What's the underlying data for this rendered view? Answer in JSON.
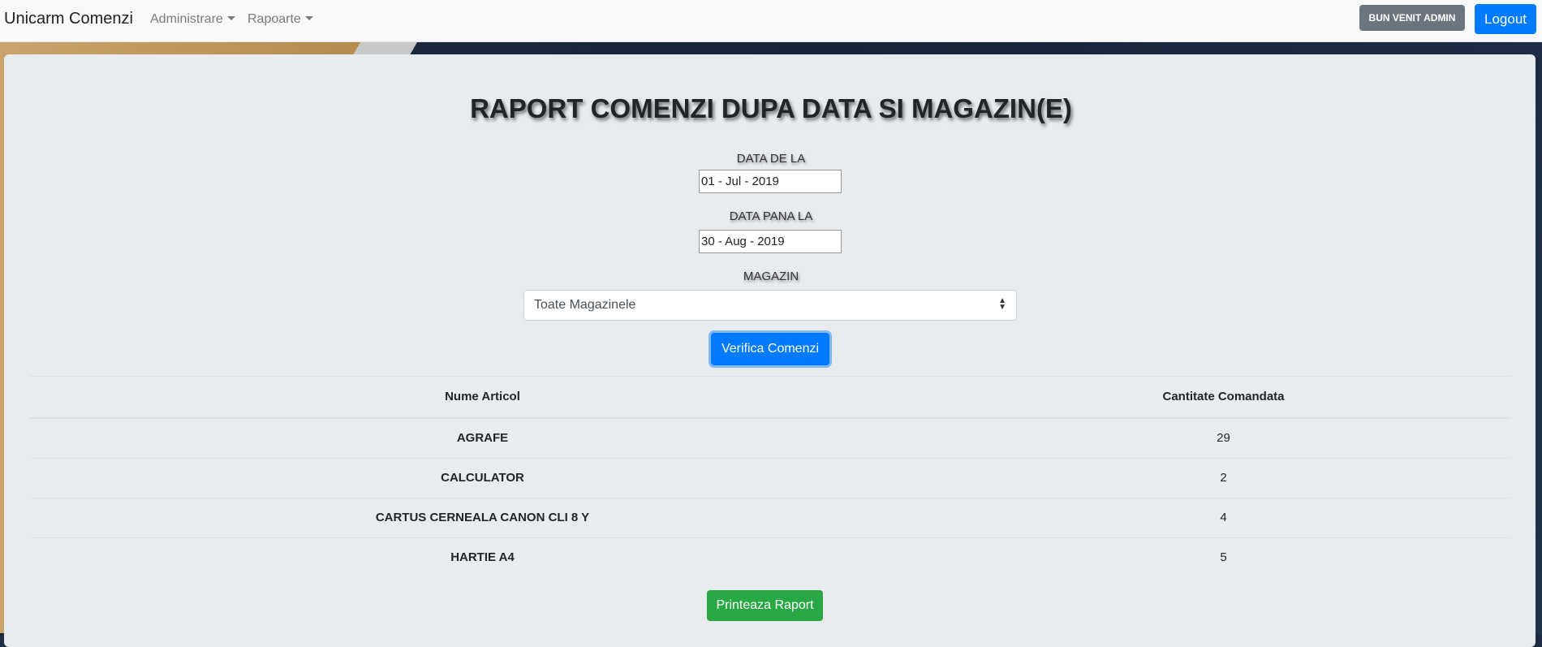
{
  "navbar": {
    "brand": "Unicarm Comenzi",
    "menu": [
      {
        "label": "Administrare"
      },
      {
        "label": "Rapoarte"
      }
    ],
    "admin_badge": "BUN VENIT ADMIN",
    "logout_label": "Logout",
    "colors": {
      "badge": "#6c757d",
      "logout": "#007bff"
    }
  },
  "report": {
    "title": "RAPORT COMENZI DUPA DATA SI MAGAZIN(E)",
    "date_from_label": "DATA DE LA",
    "date_from_value": "01 - Jul - 2019",
    "date_to_label": "DATA PANA LA",
    "date_to_value": "30 - Aug - 2019",
    "store_label": "MAGAZIN",
    "store_selected": "Toate Magazinele",
    "verify_button": "Verifica Comenzi",
    "print_button": "Printeaza Raport"
  },
  "table": {
    "headers": [
      "Nume Articol",
      "Cantitate Comandata"
    ],
    "rows": [
      {
        "name": "AGRAFE",
        "qty": "29"
      },
      {
        "name": "CALCULATOR",
        "qty": "2"
      },
      {
        "name": "CARTUS CERNEALA CANON CLI 8 Y",
        "qty": "4"
      },
      {
        "name": "HARTIE A4",
        "qty": "5"
      }
    ]
  },
  "icons": {
    "dropdown": "caret-down-icon",
    "select": "select-arrows-icon"
  }
}
